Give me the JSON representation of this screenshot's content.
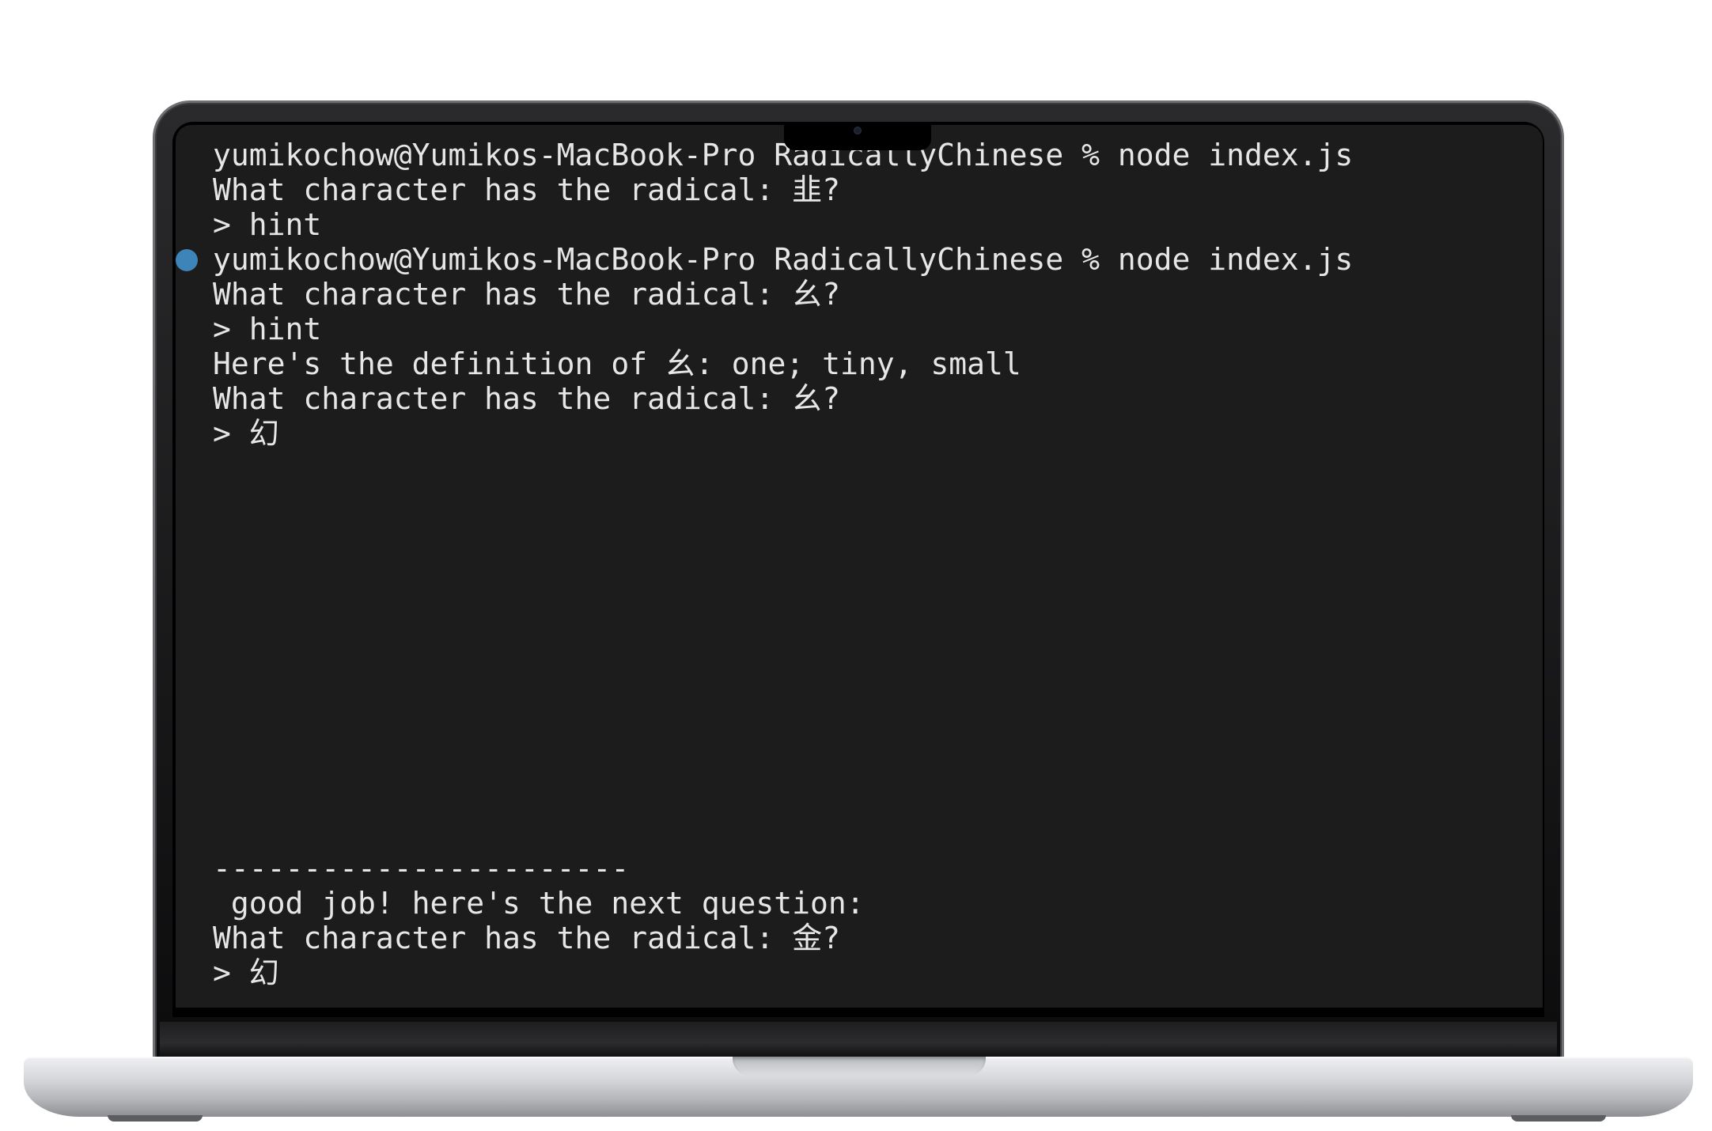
{
  "terminal": {
    "marker_color": "#3d84b8",
    "lines": [
      "yumikochow@Yumikos-MacBook-Pro RadicallyChinese % node index.js",
      "What character has the radical: 韭?",
      "> hint",
      "yumikochow@Yumikos-MacBook-Pro RadicallyChinese % node index.js",
      "What character has the radical: 幺?",
      "> hint",
      "Here's the definition of 幺: one; tiny, small",
      "What character has the radical: 幺?",
      "> 幻",
      "-----------------------",
      " good job! here's the next question:",
      "What character has the radical: 金?",
      "> 幻"
    ]
  }
}
